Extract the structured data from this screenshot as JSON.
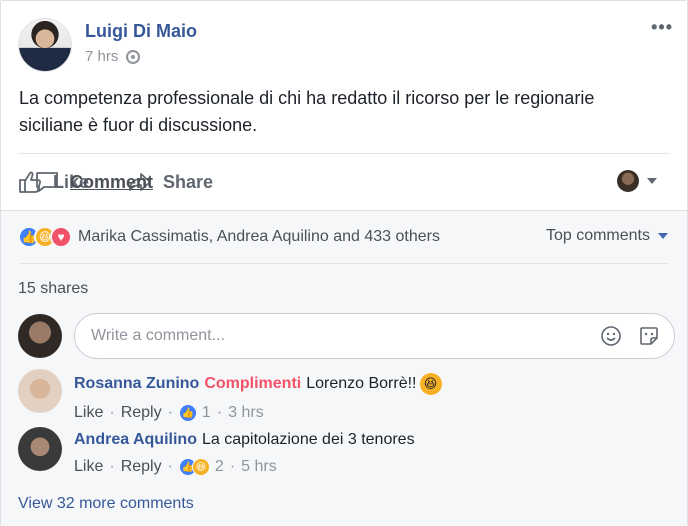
{
  "post": {
    "author": "Luigi Di Maio",
    "time": "7 hrs",
    "text": "La competenza professionale di chi ha redatto il ricorso per le regionarie siciliane è fuor di discussione.",
    "more_label": "•••"
  },
  "actions": {
    "like": "Like",
    "comment": "Comment",
    "share": "Share"
  },
  "reactions": {
    "icons": [
      "like-icon",
      "haha-icon",
      "love-icon"
    ],
    "summary": "Marika Cassimatis, Andrea Aquilino and 433 others",
    "sort_label": "Top comments"
  },
  "shares": "15 shares",
  "composer": {
    "placeholder": "Write a comment..."
  },
  "comments": [
    {
      "author": "Rosanna Zunino",
      "tag": "Complimenti",
      "text": "Lorenzo Borrè!!",
      "like": "Like",
      "reply": "Reply",
      "reaction_count": "1",
      "time": "3 hrs"
    },
    {
      "author": "Andrea Aquilino",
      "text": "La capitolazione dei 3 tenores",
      "like": "Like",
      "reply": "Reply",
      "reaction_count": "2",
      "time": "5 hrs"
    }
  ],
  "view_more": "View 32 more comments",
  "colors": {
    "link_blue": "#365899",
    "muted": "#90949c",
    "tag_red": "#f35369"
  }
}
